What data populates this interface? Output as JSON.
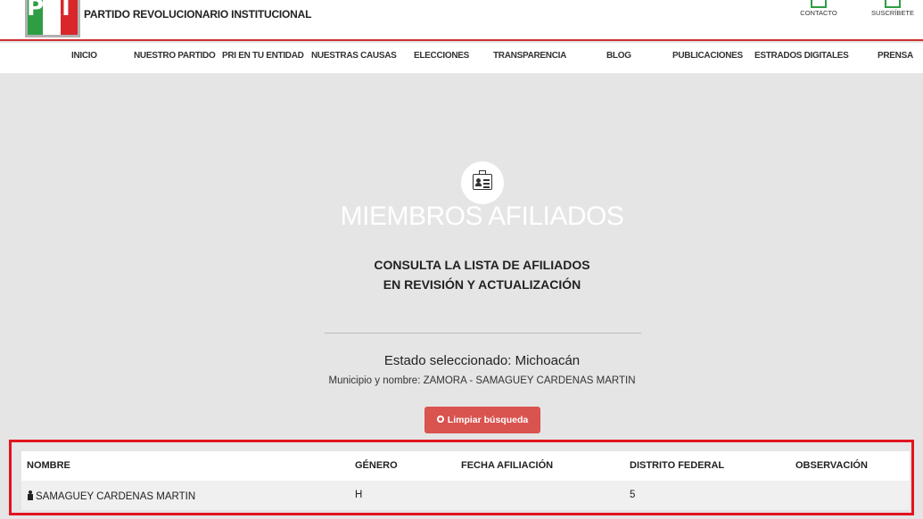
{
  "header": {
    "brand": "PARTIDO REVOLUCIONARIO INSTITUCIONAL",
    "logo_text": "PRI",
    "links": [
      {
        "label": "CONTACTO",
        "icon": "contact-icon"
      },
      {
        "label": "SUSCRÍBETE",
        "icon": "subscribe-icon"
      }
    ]
  },
  "nav": {
    "items": [
      {
        "label": "INICIO"
      },
      {
        "label": "NUESTRO PARTIDO"
      },
      {
        "label": "PRI EN TU ENTIDAD"
      },
      {
        "label": "NUESTRAS CAUSAS"
      },
      {
        "label": "ELECCIONES"
      },
      {
        "label": "TRANSPARENCIA"
      },
      {
        "label": "BLOG"
      },
      {
        "label": "PUBLICACIONES"
      },
      {
        "label": "ESTRADOS DIGITALES"
      },
      {
        "label": "PRENSA"
      }
    ]
  },
  "hero": {
    "icon": "id-card-icon",
    "title": "MIEMBROS AFILIADOS",
    "subtitle_line1": "CONSULTA LA LISTA DE AFILIADOS",
    "subtitle_line2": "EN REVISIÓN Y ACTUALIZACIÓN"
  },
  "search": {
    "estado": "Estado seleccionado: Michoacán",
    "municipio": "Municipio y nombre: ZAMORA - SAMAGUEY CARDENAS MARTIN",
    "clear_button": "Limpiar búsqueda"
  },
  "table": {
    "headers": [
      "NOMBRE",
      "GÉNERO",
      "FECHA AFILIACIÓN",
      "DISTRITO FEDERAL",
      "OBSERVACIÓN"
    ],
    "rows": [
      {
        "nombre": "SAMAGUEY CARDENAS MARTIN",
        "genero": "H",
        "fecha": "",
        "distrito": "5",
        "observacion": ""
      }
    ]
  },
  "colors": {
    "accent_red": "#d9534f",
    "highlight_red": "#e0141f",
    "brand_green": "#2e9e44",
    "background": "#e5e5e5"
  }
}
